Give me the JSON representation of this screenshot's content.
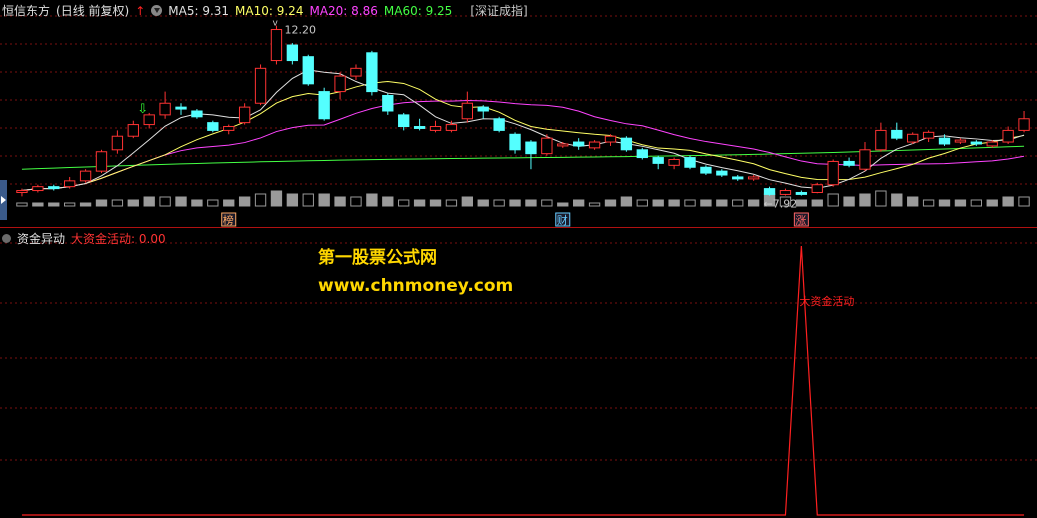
{
  "header": {
    "stock_name": "恒信东方",
    "period": "(日线 前复权)",
    "ma_legend": [
      {
        "label": "MA5: 9.31",
        "color": "#e0e0e0"
      },
      {
        "label": "MA10: 9.24",
        "color": "#ffff66"
      },
      {
        "label": "MA20: 8.86",
        "color": "#ff44ff"
      },
      {
        "label": "MA60: 9.25",
        "color": "#44ff44"
      }
    ],
    "index_name": "[深证成指]"
  },
  "indicator": {
    "name": "资金异动",
    "value_label": "大资金活动: 0.00",
    "signal_label": "大资金活动"
  },
  "watermark": {
    "line1": "第一股票公式网",
    "line2": "www.chnmoney.com"
  },
  "markers": {
    "high_label": "12.20",
    "low_label": "←7.92",
    "events": [
      {
        "label": "榜",
        "color": "#ffaa66"
      },
      {
        "label": "财",
        "color": "#66ccff"
      },
      {
        "label": "涨",
        "color": "#ff6666"
      }
    ]
  },
  "colors": {
    "up": "#ff3333",
    "down": "#54ffff",
    "ma5": "#e0e0e0",
    "ma10": "#ffff66",
    "ma20": "#ff44ff",
    "ma60": "#44ff44",
    "grid": "#7a1010",
    "signal": "#ff2020"
  },
  "chart_data": {
    "type": "candlestick",
    "price_range": [
      7.6,
      12.6
    ],
    "candles": [
      [
        8.0,
        8.05,
        7.9,
        8.1
      ],
      [
        8.05,
        8.15,
        8.0,
        8.2
      ],
      [
        8.15,
        8.1,
        8.05,
        8.2
      ],
      [
        8.15,
        8.3,
        8.1,
        8.4
      ],
      [
        8.3,
        8.55,
        8.25,
        8.6
      ],
      [
        8.55,
        9.05,
        8.5,
        9.1
      ],
      [
        9.1,
        9.45,
        9.0,
        9.6
      ],
      [
        9.45,
        9.75,
        9.4,
        9.85
      ],
      [
        9.75,
        10.0,
        9.65,
        10.05
      ],
      [
        10.0,
        10.3,
        9.9,
        10.6
      ],
      [
        10.2,
        10.15,
        10.0,
        10.3
      ],
      [
        10.1,
        9.95,
        9.9,
        10.15
      ],
      [
        9.8,
        9.6,
        9.55,
        9.85
      ],
      [
        9.6,
        9.7,
        9.5,
        9.75
      ],
      [
        9.8,
        10.2,
        9.75,
        10.3
      ],
      [
        10.3,
        11.2,
        10.25,
        11.3
      ],
      [
        11.4,
        12.2,
        11.3,
        12.3
      ],
      [
        11.8,
        11.4,
        11.3,
        11.85
      ],
      [
        11.5,
        10.8,
        10.75,
        11.55
      ],
      [
        10.6,
        9.9,
        9.85,
        10.7
      ],
      [
        10.6,
        11.0,
        10.4,
        11.1
      ],
      [
        11.0,
        11.2,
        10.9,
        11.3
      ],
      [
        11.6,
        10.6,
        10.5,
        11.65
      ],
      [
        10.5,
        10.1,
        10.0,
        10.55
      ],
      [
        10.0,
        9.7,
        9.6,
        10.05
      ],
      [
        9.7,
        9.65,
        9.6,
        9.9
      ],
      [
        9.6,
        9.7,
        9.55,
        9.85
      ],
      [
        9.6,
        9.75,
        9.55,
        9.85
      ],
      [
        9.9,
        10.3,
        9.8,
        10.6
      ],
      [
        10.2,
        10.1,
        9.9,
        10.25
      ],
      [
        9.9,
        9.6,
        9.55,
        9.95
      ],
      [
        9.5,
        9.1,
        9.0,
        9.55
      ],
      [
        9.3,
        9.0,
        8.6,
        9.35
      ],
      [
        9.0,
        9.4,
        8.95,
        9.5
      ],
      [
        9.2,
        9.25,
        9.15,
        9.3
      ],
      [
        9.3,
        9.2,
        9.1,
        9.4
      ],
      [
        9.15,
        9.3,
        9.1,
        9.35
      ],
      [
        9.3,
        9.45,
        9.2,
        9.5
      ],
      [
        9.4,
        9.1,
        9.05,
        9.45
      ],
      [
        9.1,
        8.9,
        8.85,
        9.15
      ],
      [
        8.9,
        8.75,
        8.6,
        8.95
      ],
      [
        8.7,
        8.85,
        8.6,
        8.9
      ],
      [
        8.9,
        8.65,
        8.6,
        8.95
      ],
      [
        8.65,
        8.5,
        8.45,
        8.7
      ],
      [
        8.55,
        8.45,
        8.4,
        8.6
      ],
      [
        8.4,
        8.35,
        8.3,
        8.45
      ],
      [
        8.35,
        8.4,
        8.3,
        8.45
      ],
      [
        8.1,
        7.95,
        7.92,
        8.15
      ],
      [
        7.95,
        8.05,
        7.92,
        8.1
      ],
      [
        8.0,
        7.95,
        7.92,
        8.05
      ],
      [
        8.0,
        8.2,
        7.98,
        8.25
      ],
      [
        8.2,
        8.8,
        8.15,
        8.85
      ],
      [
        8.8,
        8.7,
        8.65,
        8.9
      ],
      [
        8.6,
        9.1,
        8.55,
        9.3
      ],
      [
        9.1,
        9.6,
        9.05,
        9.8
      ],
      [
        9.6,
        9.4,
        9.35,
        9.8
      ],
      [
        9.3,
        9.5,
        9.25,
        9.55
      ],
      [
        9.4,
        9.55,
        9.3,
        9.6
      ],
      [
        9.4,
        9.25,
        9.2,
        9.5
      ],
      [
        9.3,
        9.35,
        9.25,
        9.4
      ],
      [
        9.3,
        9.25,
        9.2,
        9.35
      ],
      [
        9.2,
        9.3,
        9.15,
        9.35
      ],
      [
        9.3,
        9.6,
        9.25,
        9.7
      ],
      [
        9.6,
        9.9,
        9.55,
        10.1
      ]
    ],
    "volume": [
      1,
      1,
      1,
      1,
      1,
      2,
      2,
      2,
      3,
      3,
      3,
      2,
      2,
      2,
      3,
      4,
      5,
      4,
      4,
      4,
      3,
      3,
      4,
      3,
      2,
      2,
      2,
      2,
      3,
      2,
      2,
      2,
      2,
      2,
      1,
      2,
      1,
      2,
      3,
      2,
      2,
      2,
      2,
      2,
      2,
      2,
      2,
      4,
      3,
      2,
      2,
      4,
      3,
      4,
      5,
      4,
      3,
      2,
      2,
      2,
      2,
      2,
      3,
      3
    ],
    "signal": [
      0,
      0,
      0,
      0,
      0,
      0,
      0,
      0,
      0,
      0,
      0,
      0,
      0,
      0,
      0,
      0,
      0,
      0,
      0,
      0,
      0,
      0,
      0,
      0,
      0,
      0,
      0,
      0,
      0,
      0,
      0,
      0,
      0,
      0,
      0,
      0,
      0,
      0,
      0,
      0,
      0,
      0,
      0,
      0,
      0,
      0,
      0,
      0,
      0,
      1,
      0,
      0,
      0,
      0,
      0,
      0,
      0,
      0,
      0,
      0,
      0,
      0,
      0,
      0
    ]
  }
}
